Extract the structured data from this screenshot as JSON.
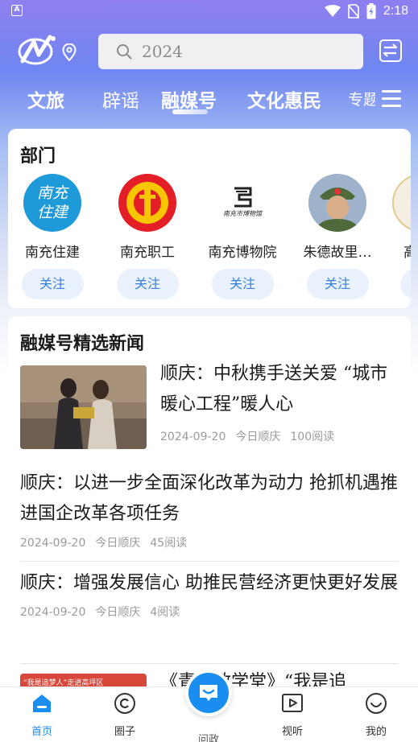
{
  "status_bar": {
    "time": "2:18",
    "notification_glyph": "A"
  },
  "header": {
    "search_text": "2024"
  },
  "tabs": [
    {
      "label": "文旅"
    },
    {
      "label": "辟谣"
    },
    {
      "label": "融媒号"
    },
    {
      "label": "文化惠民"
    },
    {
      "label": "专题"
    }
  ],
  "departments": {
    "title": "部门",
    "items": [
      {
        "name": "南充住建",
        "follow": "关注",
        "logo_text": "南充住建"
      },
      {
        "name": "南充职工",
        "follow": "关注"
      },
      {
        "name": "南充博物院",
        "follow": "关注",
        "logo_text": "南充市博物馆"
      },
      {
        "name": "朱德故里…",
        "follow": "关注"
      },
      {
        "name": "高",
        "follow": "关"
      }
    ]
  },
  "news": {
    "title": "融媒号精选新闻",
    "items": [
      {
        "title": "顺庆：中秋携手送关爱 “城市暖心工程”暖人心",
        "date": "2024-09-20",
        "source": "今日顺庆",
        "reads": "100阅读"
      },
      {
        "title": "顺庆：以进一步全面深化改革为动力 抢抓机遇推进国企改革各项任务",
        "date": "2024-09-20",
        "source": "今日顺庆",
        "reads": "45阅读"
      },
      {
        "title": "顺庆：增强发展信心 助推民营经济更快更好发展",
        "date": "2024-09-20",
        "source": "今日顺庆",
        "reads": "4阅读"
      },
      {
        "title": "《青年政学堂》“我是追",
        "banner_text": "“我是追梦人”走进高坪区"
      }
    ]
  },
  "bottom_nav": [
    {
      "label": "首页",
      "active": true
    },
    {
      "label": "圈子"
    },
    {
      "label": "问政"
    },
    {
      "label": "视听"
    },
    {
      "label": "我的"
    }
  ],
  "colors": {
    "accent": "#1a8ef0",
    "follow_text": "#3880e0",
    "follow_bg": "#e8f1fc"
  }
}
